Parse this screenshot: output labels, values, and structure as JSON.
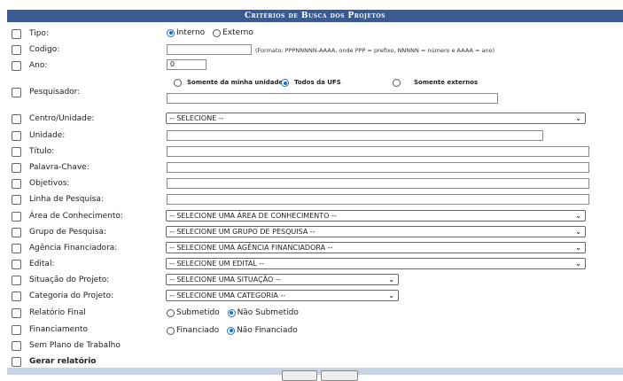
{
  "title": "Critérios de Busca dos Projetos",
  "tipo": {
    "label": "Tipo:",
    "options": [
      "Interno",
      "Externo"
    ],
    "selected": "Interno"
  },
  "codigo": {
    "label": "Codigo:",
    "value": "",
    "hint": "(Formato: PPPNNNNN-AAAA, onde PPP = prefixo, NNNNN = número e AAAA = ano)"
  },
  "ano": {
    "label": "Ano:",
    "value": "0"
  },
  "pesquisador": {
    "label": "Pesquisador:",
    "options": [
      "Somente da minha unidade",
      "Todos da UFS",
      "Somente externos"
    ],
    "selected": "Todos da UFS",
    "value": ""
  },
  "centro": {
    "label": "Centro/Unidade:",
    "value": "-- SELECIONE --"
  },
  "unidade": {
    "label": "Unidade:",
    "value": ""
  },
  "titulo": {
    "label": "Título:",
    "value": ""
  },
  "palavra_chave": {
    "label": "Palavra-Chave:",
    "value": ""
  },
  "objetivos": {
    "label": "Objetivos:",
    "value": ""
  },
  "linha": {
    "label": "Linha de Pesquisa:",
    "value": ""
  },
  "area": {
    "label": "Área de Conhecimento:",
    "value": "-- SELECIONE UMA ÁREA DE CONHECIMENTO --"
  },
  "grupo": {
    "label": "Grupo de Pesquisa:",
    "value": "-- SELECIONE UM GRUPO DE PESQUISA --"
  },
  "agencia": {
    "label": "Agência Financiadora:",
    "value": "-- SELECIONE UMA AGÊNCIA FINANCIADORA --"
  },
  "edital": {
    "label": "Edital:",
    "value": "-- SELECIONE UM EDITAL --"
  },
  "situacao": {
    "label": "Situação do Projeto:",
    "value": "-- SELECIONE UMA SITUAÇÃO --"
  },
  "categoria": {
    "label": "Categoria do Projeto:",
    "value": "-- SELECIONE UMA CATEGORIA --"
  },
  "relatorio": {
    "label": "Relatório Final",
    "options": [
      "Submetido",
      "Não Submetido"
    ],
    "selected": "Não Submetido"
  },
  "financiamento": {
    "label": "Financiamento",
    "options": [
      "Financiado",
      "Não Financiado"
    ],
    "selected": "Não Financiado"
  },
  "sem_plano": {
    "label": "Sem Plano de Trabalho"
  },
  "gerar": {
    "label": "Gerar relatório"
  }
}
